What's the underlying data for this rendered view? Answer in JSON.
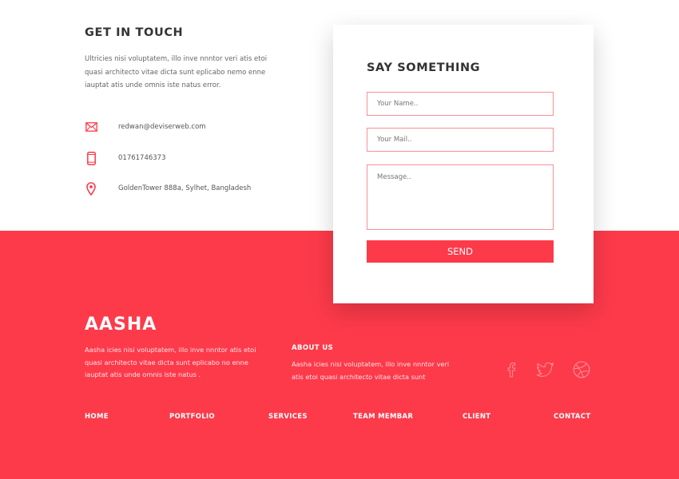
{
  "contact": {
    "title": "GET IN TOUCH",
    "description": "Ultricies nisi voluptatem, illo inve nnntor veri atis etoi quasi architecto vitae dicta sunt eplicabo nemo enne iauptat atis unde omnis iste natus error.",
    "email": "redwan@deviserweb.com",
    "phone": "01761746373",
    "address": "GoldenTower 888a, Sylhet, Bangladesh",
    "icons": [
      "mail-icon",
      "phone-icon",
      "location-pin-icon"
    ]
  },
  "form": {
    "title": "SAY SOMETHING",
    "name_placeholder": "Your Name..",
    "mail_placeholder": "Your Mail..",
    "message_placeholder": "Message..",
    "send_label": "SEND"
  },
  "footer": {
    "brand": "AASHA",
    "brand_description": "Aasha icies nisi voluptatem, illo inve nnntor atis etoi quasi architecto vitae dicta sunt eplicabo no enne iauptat atis unde omnis iste natus .",
    "about_title": "ABOUT US",
    "about_description": "Aasha icies nisi voluptatem, illo inve nnntor veri atis etoi quasi architecto vitae dicta sunt",
    "social_icons": [
      "facebook-icon",
      "twitter-icon",
      "dribbble-icon"
    ],
    "nav": [
      "HOME",
      "PORTFOLIO",
      "SERVICES",
      "TEAM MEMBAR",
      "CLIENT",
      "CONTACT"
    ]
  },
  "colors": {
    "accent": "#fd3a4a",
    "input_border": "#fb8e97",
    "heading": "#333333"
  }
}
